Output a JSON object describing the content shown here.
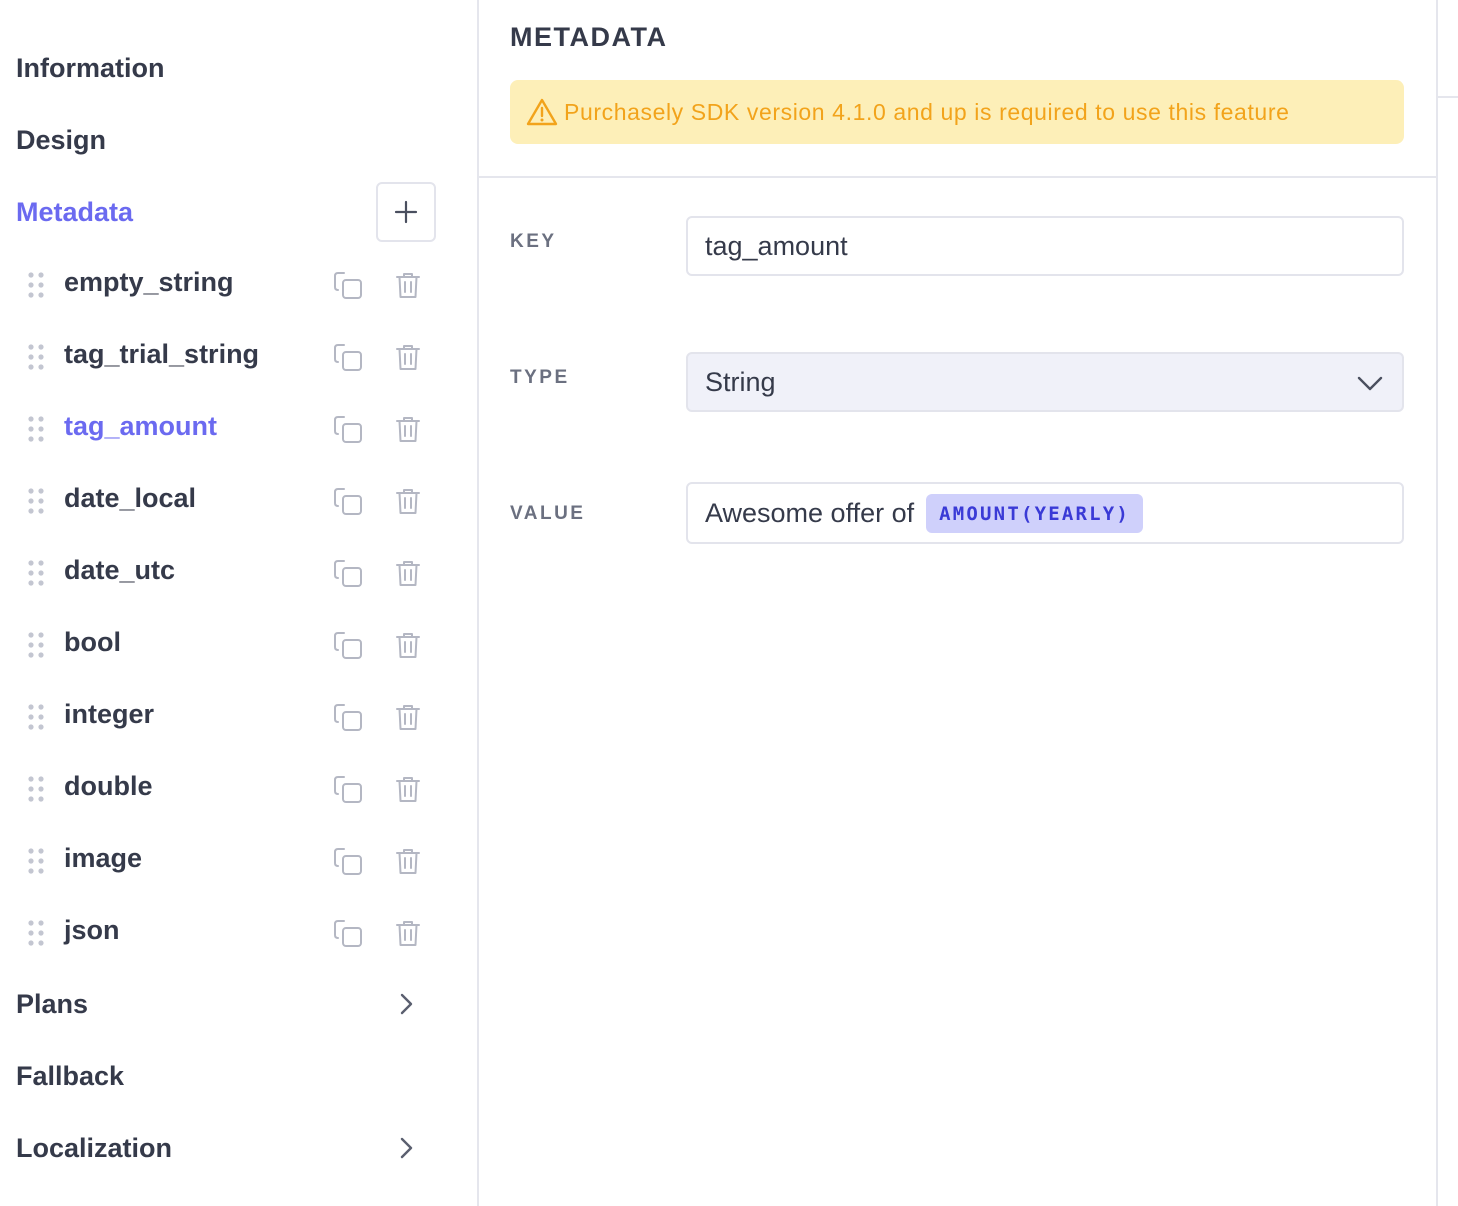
{
  "sidebar": {
    "nav_top": [
      {
        "label": "Information"
      },
      {
        "label": "Design"
      }
    ],
    "metadata_section": {
      "label": "Metadata",
      "add_icon": "plus-icon"
    },
    "metadata_items": [
      {
        "label": "empty_string"
      },
      {
        "label": "tag_trial_string"
      },
      {
        "label": "tag_amount",
        "selected": true
      },
      {
        "label": "date_local"
      },
      {
        "label": "date_utc"
      },
      {
        "label": "bool"
      },
      {
        "label": "integer"
      },
      {
        "label": "double"
      },
      {
        "label": "image"
      },
      {
        "label": "json"
      }
    ],
    "nav_bottom": [
      {
        "label": "Plans",
        "has_chevron": true
      },
      {
        "label": "Fallback",
        "has_chevron": false
      },
      {
        "label": "Localization",
        "has_chevron": true
      }
    ]
  },
  "main": {
    "title": "METADATA",
    "warning": {
      "icon": "warning-triangle-icon",
      "text": "Purchasely SDK version 4.1.0 and up is required to use this feature"
    },
    "fields": {
      "key": {
        "label": "KEY",
        "value": "tag_amount"
      },
      "type": {
        "label": "TYPE",
        "value": "String"
      },
      "value": {
        "label": "VALUE",
        "text": "Awesome offer of",
        "tag": "AMOUNT(YEARLY)"
      }
    }
  },
  "colors": {
    "accent": "#6b6af0",
    "text": "#353a4a",
    "warning_bg": "#fdefb8",
    "warning_text": "#f2a31b",
    "tag_bg": "#cfd0fb",
    "tag_text": "#3a3ad6"
  }
}
